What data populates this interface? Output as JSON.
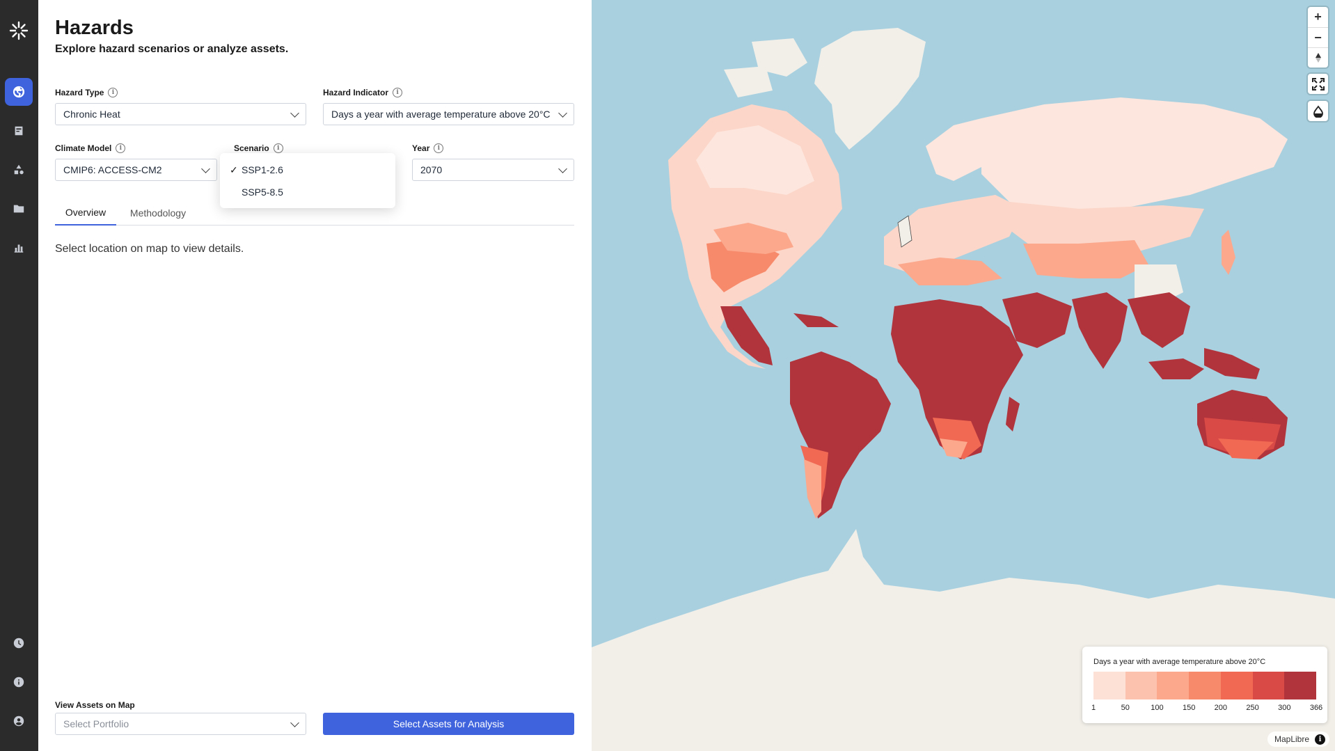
{
  "page": {
    "title": "Hazards",
    "subtitle": "Explore hazard scenarios or analyze assets."
  },
  "sidebar": {
    "items": [
      {
        "icon": "globe-icon",
        "active": true
      },
      {
        "icon": "document-icon",
        "active": false
      },
      {
        "icon": "shapes-icon",
        "active": false
      },
      {
        "icon": "folder-icon",
        "active": false
      },
      {
        "icon": "bar-chart-icon",
        "active": false
      },
      {
        "icon": "clock-icon",
        "active": false
      },
      {
        "icon": "info-icon",
        "active": false
      },
      {
        "icon": "user-icon",
        "active": false
      }
    ]
  },
  "filters": {
    "hazard_type": {
      "label": "Hazard Type",
      "value": "Chronic Heat"
    },
    "hazard_indicator": {
      "label": "Hazard Indicator",
      "value": "Days a year with average temperature above 20°C"
    },
    "climate_model": {
      "label": "Climate Model",
      "value": "CMIP6: ACCESS-CM2"
    },
    "scenario": {
      "label": "Scenario",
      "selected": "SSP1-2.6",
      "options": [
        "SSP1-2.6",
        "SSP5-8.5"
      ]
    },
    "year": {
      "label": "Year",
      "value": "2070"
    }
  },
  "tabs": [
    {
      "label": "Overview",
      "active": true
    },
    {
      "label": "Methodology",
      "active": false
    }
  ],
  "overview": {
    "message": "Select location on map to view details."
  },
  "footer": {
    "view_assets_label": "View Assets on Map",
    "portfolio_placeholder": "Select Portfolio",
    "analysis_button": "Select Assets for Analysis"
  },
  "map": {
    "controls": {
      "zoom_in": "+",
      "zoom_out": "−"
    },
    "legend": {
      "title": "Days a year with average temperature above 20°C",
      "ticks": [
        "1",
        "50",
        "100",
        "150",
        "200",
        "250",
        "300",
        "366"
      ],
      "colors": [
        "#fde0d6",
        "#fcc2ad",
        "#fba88d",
        "#f88a6c",
        "#f16853",
        "#d94a46",
        "#b1333b"
      ]
    },
    "attribution": "MapLibre",
    "colors": {
      "ocean": "#a8d0df",
      "land": "#f2efe9"
    }
  },
  "colors": {
    "accent": "#3e63dd",
    "sidebar": "#2b2b2b"
  }
}
